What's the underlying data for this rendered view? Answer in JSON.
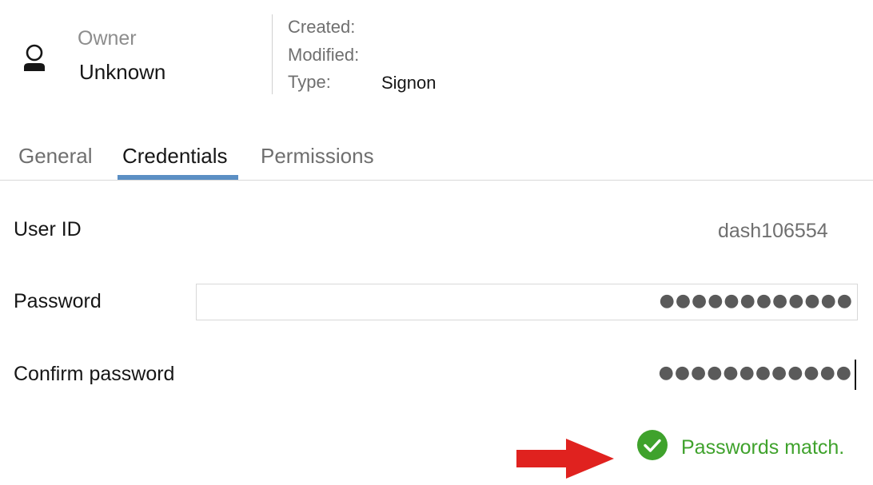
{
  "header": {
    "owner_label": "Owner",
    "owner_value": "Unknown",
    "created_label": "Created:",
    "modified_label": "Modified:",
    "type_label": "Type:",
    "type_value": "Signon"
  },
  "tabs": [
    {
      "label": "General",
      "active": false
    },
    {
      "label": "Credentials",
      "active": true
    },
    {
      "label": "Permissions",
      "active": false
    }
  ],
  "form": {
    "user_id_label": "User ID",
    "user_id_value": "dash106554",
    "password_label": "Password",
    "password_value": "●●●●●●●●●●●●",
    "confirm_label": "Confirm password",
    "confirm_value": "●●●●●●●●●●●●"
  },
  "status": {
    "message": "Passwords match.",
    "icon": "check-circle-icon",
    "color": "#3fa22c"
  },
  "annotation": {
    "arrow_color": "#e0221f",
    "icon": "red-arrow-icon"
  },
  "colors": {
    "active_tab_indicator": "#5b8fc4"
  }
}
